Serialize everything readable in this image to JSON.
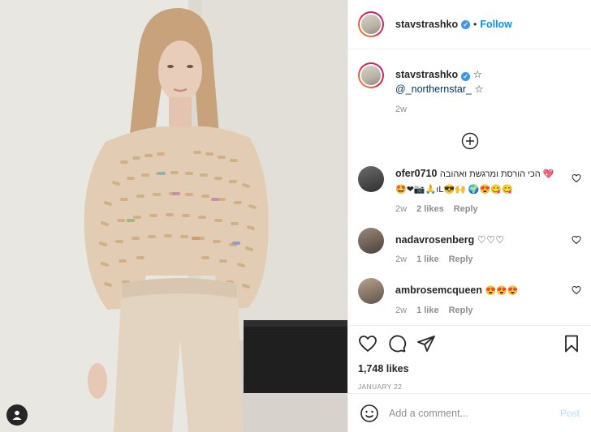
{
  "post": {
    "author": "stavstrashko",
    "follow_label": "Follow",
    "separator": "•"
  },
  "caption": {
    "username": "stavstrashko",
    "prefix": "☆ ",
    "mention": "@_northernstar_",
    "suffix": " ☆",
    "time": "2w"
  },
  "comments": [
    {
      "username": "ofer0710",
      "text": "הכי הורסת ומרגשת ואהובה 💖🤩❤📷🙏ıL😎🙌 🌍😍😋😋",
      "time": "2w",
      "likes": "2 likes",
      "reply": "Reply"
    },
    {
      "username": "nadavrosenberg",
      "text": "♡♡♡",
      "time": "2w",
      "likes": "1 like",
      "reply": "Reply"
    },
    {
      "username": "ambrosemcqueen",
      "text": "😍😍😍",
      "time": "2w",
      "likes": "1 like",
      "reply": "Reply"
    }
  ],
  "actions": {
    "likes": "1,748 likes",
    "date": "JANUARY 22"
  },
  "add_comment": {
    "placeholder": "Add a comment...",
    "post_label": "Post"
  },
  "icons": {
    "like": "heart-icon",
    "comment": "comment-icon",
    "share": "paper-plane-icon",
    "save": "bookmark-icon",
    "emoji": "smiley-icon",
    "load_more": "plus-circle-icon",
    "tags": "user-tag-icon"
  },
  "colors": {
    "link": "#0095f6",
    "verified": "#3897f0",
    "text": "#262626",
    "muted": "#8e8e8e",
    "post_disabled": "#b2dffc"
  }
}
